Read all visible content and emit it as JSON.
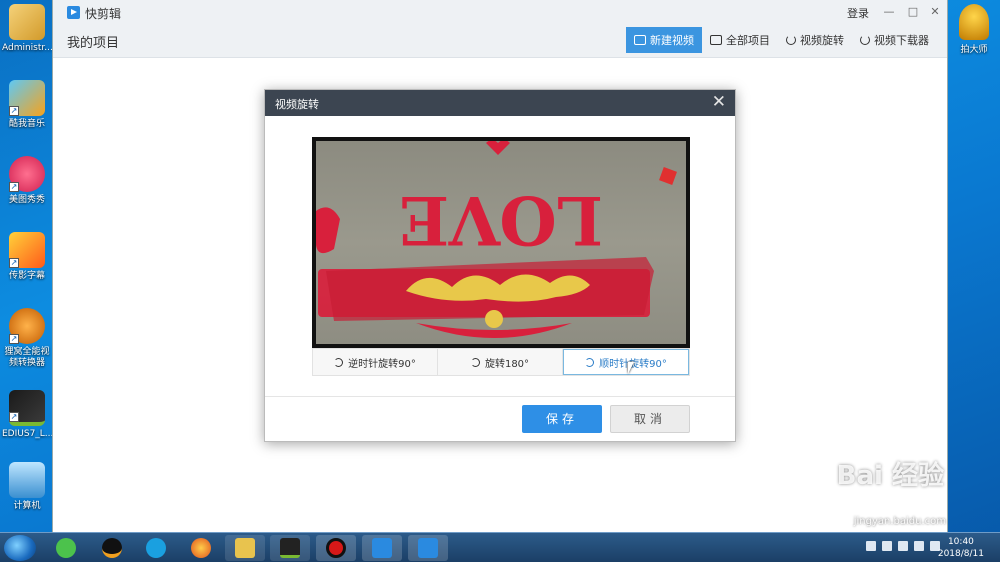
{
  "desktop": {
    "icons": [
      {
        "label": "Administr...",
        "color": "#e9b84a"
      },
      {
        "label": "酷我音乐",
        "color": "#f7a21b"
      },
      {
        "label": "美图秀秀",
        "color": "#e8335f"
      },
      {
        "label": "传影字幕",
        "color": "#ff7a1a"
      },
      {
        "label": "狸窝全能视频转换器",
        "color": "#f08a1c"
      },
      {
        "label": "EDIUS7_L...",
        "color": "#7ab932"
      },
      {
        "label": "计算机",
        "color": "#5bb2e6"
      }
    ],
    "right_icon_label": "拍大师"
  },
  "app": {
    "title": "快剪辑",
    "login": "登录",
    "window_controls": {
      "minimize": "—",
      "maximize": "□",
      "close": "✕"
    },
    "page_title": "我的项目",
    "nav": [
      {
        "label": "新建视频",
        "icon": "video-camera-icon",
        "active": true
      },
      {
        "label": "全部项目",
        "icon": "folder-icon",
        "active": false
      },
      {
        "label": "视频旋转",
        "icon": "rotate-icon",
        "active": false
      },
      {
        "label": "视频下载器",
        "icon": "cloud-download-icon",
        "active": false
      }
    ],
    "accent": "#3b95e0"
  },
  "modal": {
    "title": "视频旋转",
    "close": "✕",
    "preview_text": "LOVE",
    "rotate_buttons": [
      {
        "label": "逆时针旋转90°",
        "active": false
      },
      {
        "label": "旋转180°",
        "active": false
      },
      {
        "label": "顺时针旋转90°",
        "active": true
      }
    ],
    "save": "保存",
    "cancel": "取消"
  },
  "taskbar": {
    "tasks": [
      {
        "icon": "360-browser-icon",
        "color": "#4cc24c"
      },
      {
        "icon": "qq-icon",
        "color": "#111111"
      },
      {
        "icon": "media-player-icon",
        "color": "#1aa0e0"
      },
      {
        "icon": "firefox-icon",
        "color": "#f07a1c"
      },
      {
        "icon": "file-explorer-icon",
        "color": "#e8c34e"
      },
      {
        "icon": "edius-icon",
        "color": "#7ab932"
      },
      {
        "icon": "record-icon",
        "color": "#d61818"
      },
      {
        "icon": "kuaijianji-icon",
        "color": "#2a8ae0"
      },
      {
        "icon": "video-rotate-icon",
        "color": "#2a8ae0"
      }
    ],
    "time": "10:40",
    "date": "2018/8/11"
  },
  "watermark": {
    "brand": "Bai 经验",
    "url": "jingyan.baidu.com"
  }
}
